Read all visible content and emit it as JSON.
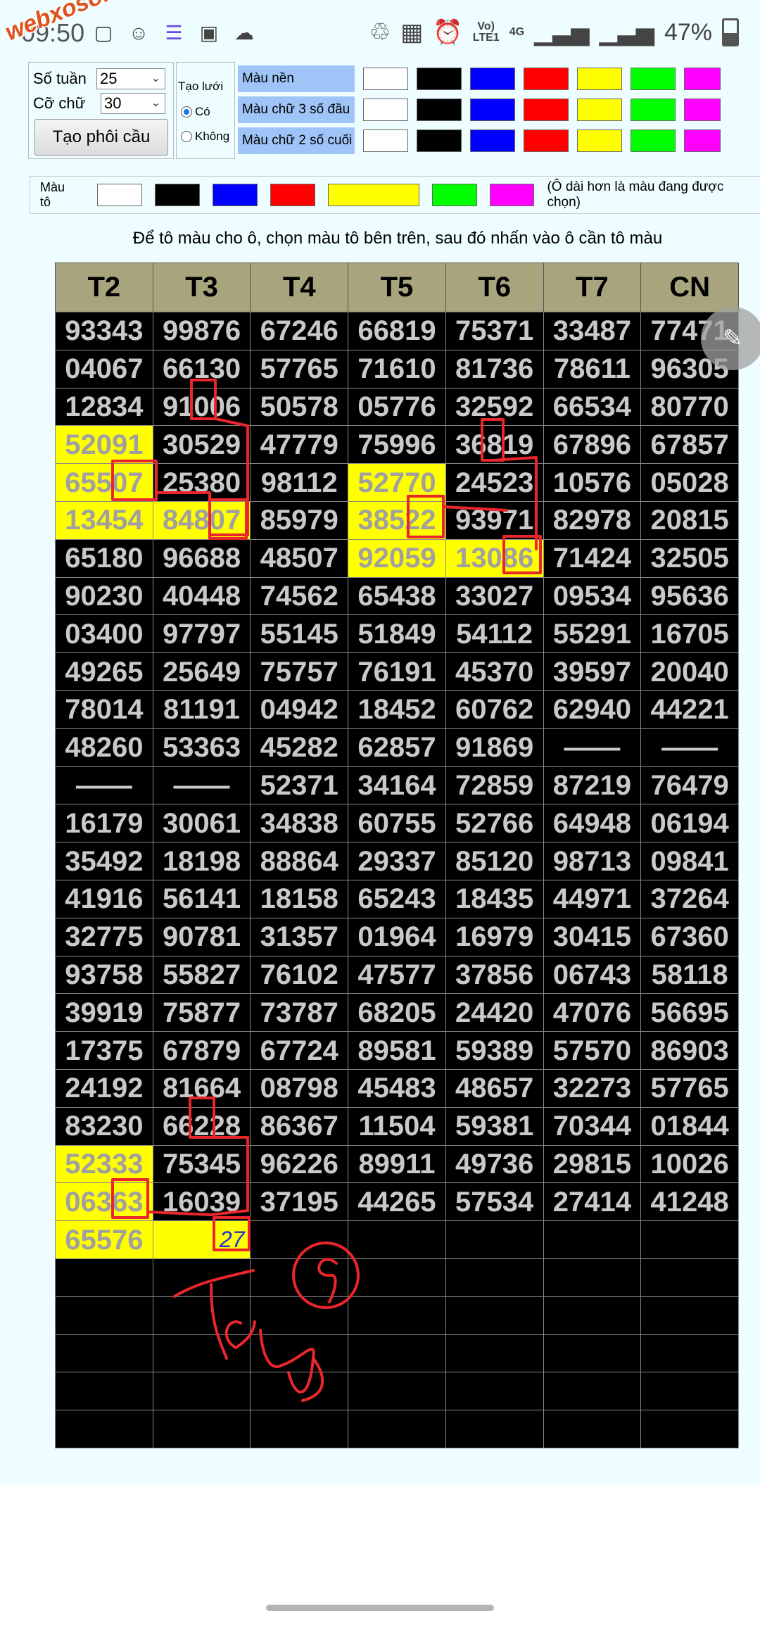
{
  "status": {
    "time": "09:50",
    "watermark": "webxoso.net",
    "net_top": "Vo)",
    "net_bottom": "LTE1",
    "gen": "4G",
    "battery": "47%"
  },
  "controls": {
    "so_tuan_label": "Số tuần",
    "so_tuan_value": "25",
    "co_chu_label": "Cỡ chữ",
    "co_chu_value": "30",
    "create_button": "Tạo phôi cầu",
    "tao_luoi_label": "Tạo lưới",
    "radio_co": "Có",
    "radio_khong": "Không"
  },
  "color_rows": [
    {
      "label": "Màu nền"
    },
    {
      "label": "Màu chữ 3 số đầu"
    },
    {
      "label": "Màu chữ 2 số cuối"
    }
  ],
  "palette": [
    "#ffffff",
    "#000000",
    "#0000ff",
    "#ff0000",
    "#ffff00",
    "#00ff00",
    "#ff00ff"
  ],
  "mau_to": {
    "label": "Màu tô",
    "note": "(Ô dài hơn là màu đang được chọn)"
  },
  "instruction": "Để tô màu cho ô, chọn màu tô bên trên, sau đó nhấn vào ô cần tô màu",
  "grid": {
    "headers": [
      "T2",
      "T3",
      "T4",
      "T5",
      "T6",
      "T7",
      "CN"
    ],
    "rows": [
      [
        "93343",
        "99876",
        "67246",
        "66819",
        "75371",
        "33487",
        "77471"
      ],
      [
        "04067",
        "66130",
        "57765",
        "71610",
        "81736",
        "78611",
        "96305"
      ],
      [
        "12834",
        "91006",
        "50578",
        "05776",
        "32592",
        "66534",
        "80770"
      ],
      [
        "52091",
        "30529",
        "47779",
        "75996",
        "36819",
        "67896",
        "67857"
      ],
      [
        "65507",
        "25380",
        "98112",
        "52770",
        "24523",
        "10576",
        "05028"
      ],
      [
        "13454",
        "84807",
        "85979",
        "38522",
        "93971",
        "82978",
        "20815"
      ],
      [
        "65180",
        "96688",
        "48507",
        "92059",
        "13086",
        "71424",
        "32505"
      ],
      [
        "90230",
        "40448",
        "74562",
        "65438",
        "33027",
        "09534",
        "95636"
      ],
      [
        "03400",
        "97797",
        "55145",
        "51849",
        "54112",
        "55291",
        "16705"
      ],
      [
        "49265",
        "25649",
        "75757",
        "76191",
        "45370",
        "39597",
        "20040"
      ],
      [
        "78014",
        "81191",
        "04942",
        "18452",
        "60762",
        "62940",
        "44221"
      ],
      [
        "48260",
        "53363",
        "45282",
        "62857",
        "91869",
        "——",
        "——"
      ],
      [
        "——",
        "——",
        "52371",
        "34164",
        "72859",
        "87219",
        "76479"
      ],
      [
        "16179",
        "30061",
        "34838",
        "60755",
        "52766",
        "64948",
        "06194"
      ],
      [
        "35492",
        "18198",
        "88864",
        "29337",
        "85120",
        "98713",
        "09841"
      ],
      [
        "41916",
        "56141",
        "18158",
        "65243",
        "18435",
        "44971",
        "37264"
      ],
      [
        "32775",
        "90781",
        "31357",
        "01964",
        "16979",
        "30415",
        "67360"
      ],
      [
        "93758",
        "55827",
        "76102",
        "47577",
        "37856",
        "06743",
        "58118"
      ],
      [
        "39919",
        "75877",
        "73787",
        "68205",
        "24420",
        "47076",
        "56695"
      ],
      [
        "17375",
        "67879",
        "67724",
        "89581",
        "59389",
        "57570",
        "86903"
      ],
      [
        "24192",
        "81664",
        "08798",
        "45483",
        "48657",
        "32273",
        "57765"
      ],
      [
        "83230",
        "66228",
        "86367",
        "11504",
        "59381",
        "70344",
        "01844"
      ],
      [
        "52333",
        "75345",
        "96226",
        "89911",
        "49736",
        "29815",
        "10026"
      ],
      [
        "06363",
        "16039",
        "37195",
        "44265",
        "57534",
        "27414",
        "41248"
      ],
      [
        "65576",
        "",
        "",
        "",
        "",
        "",
        ""
      ],
      [
        "",
        "",
        "",
        "",
        "",
        "",
        ""
      ],
      [
        "",
        "",
        "",
        "",
        "",
        "",
        ""
      ],
      [
        "",
        "",
        "",
        "",
        "",
        "",
        ""
      ],
      [
        "",
        "",
        "",
        "",
        "",
        "",
        ""
      ],
      [
        "",
        "",
        "",
        "",
        "",
        "",
        ""
      ]
    ],
    "highlighted": [
      [
        3,
        0
      ],
      [
        4,
        0
      ],
      [
        5,
        0
      ],
      [
        5,
        1
      ],
      [
        4,
        3
      ],
      [
        5,
        3
      ],
      [
        6,
        3
      ],
      [
        6,
        4
      ],
      [
        22,
        0
      ],
      [
        23,
        0
      ],
      [
        24,
        0
      ],
      [
        24,
        1
      ]
    ]
  },
  "annotations": {
    "cell_note": "27"
  },
  "colors": {
    "header_bg": "#a8a47e",
    "highlight": "#ffff00",
    "annotation": "#e8262b"
  }
}
